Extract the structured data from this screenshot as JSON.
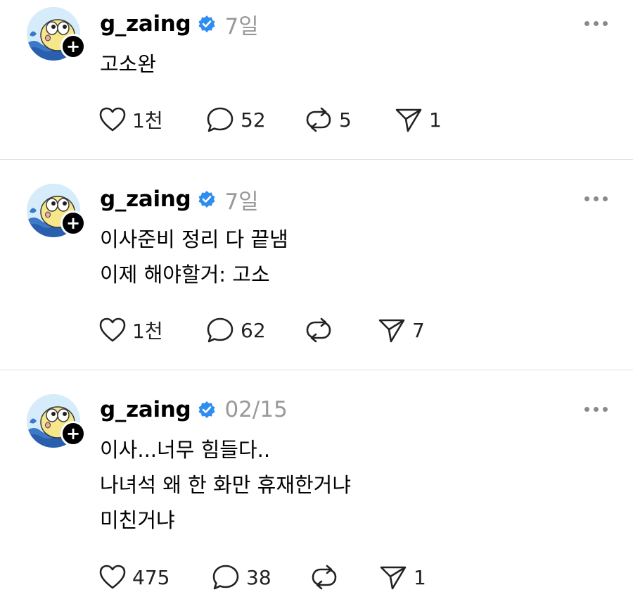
{
  "posts": [
    {
      "username": "g_zaing",
      "time": "7일",
      "lines": [
        "고소완"
      ],
      "likes": "1천",
      "replies": "52",
      "reposts": "5",
      "shares": "1"
    },
    {
      "username": "g_zaing",
      "time": "7일",
      "lines": [
        "이사준비 정리 다 끝냄",
        "이제 해야할거: 고소"
      ],
      "likes": "1천",
      "replies": "62",
      "reposts": "",
      "shares": "7"
    },
    {
      "username": "g_zaing",
      "time": "02/15",
      "lines": [
        "이사...너무 힘들다..",
        "나녀석 왜 한 화만 휴재한거냐",
        "미친거냐"
      ],
      "likes": "475",
      "replies": "38",
      "reposts": "",
      "shares": "1"
    }
  ],
  "colors": {
    "verified": "#2f8cf0",
    "timestamp": "#999999",
    "divider": "#e0e0e0"
  },
  "icons": {
    "like": "heart-icon",
    "reply": "speech-bubble-icon",
    "repost": "repost-arrows-icon",
    "share": "paper-plane-icon",
    "more": "more-dots-icon",
    "verified": "verified-badge-icon",
    "follow": "plus-icon"
  }
}
